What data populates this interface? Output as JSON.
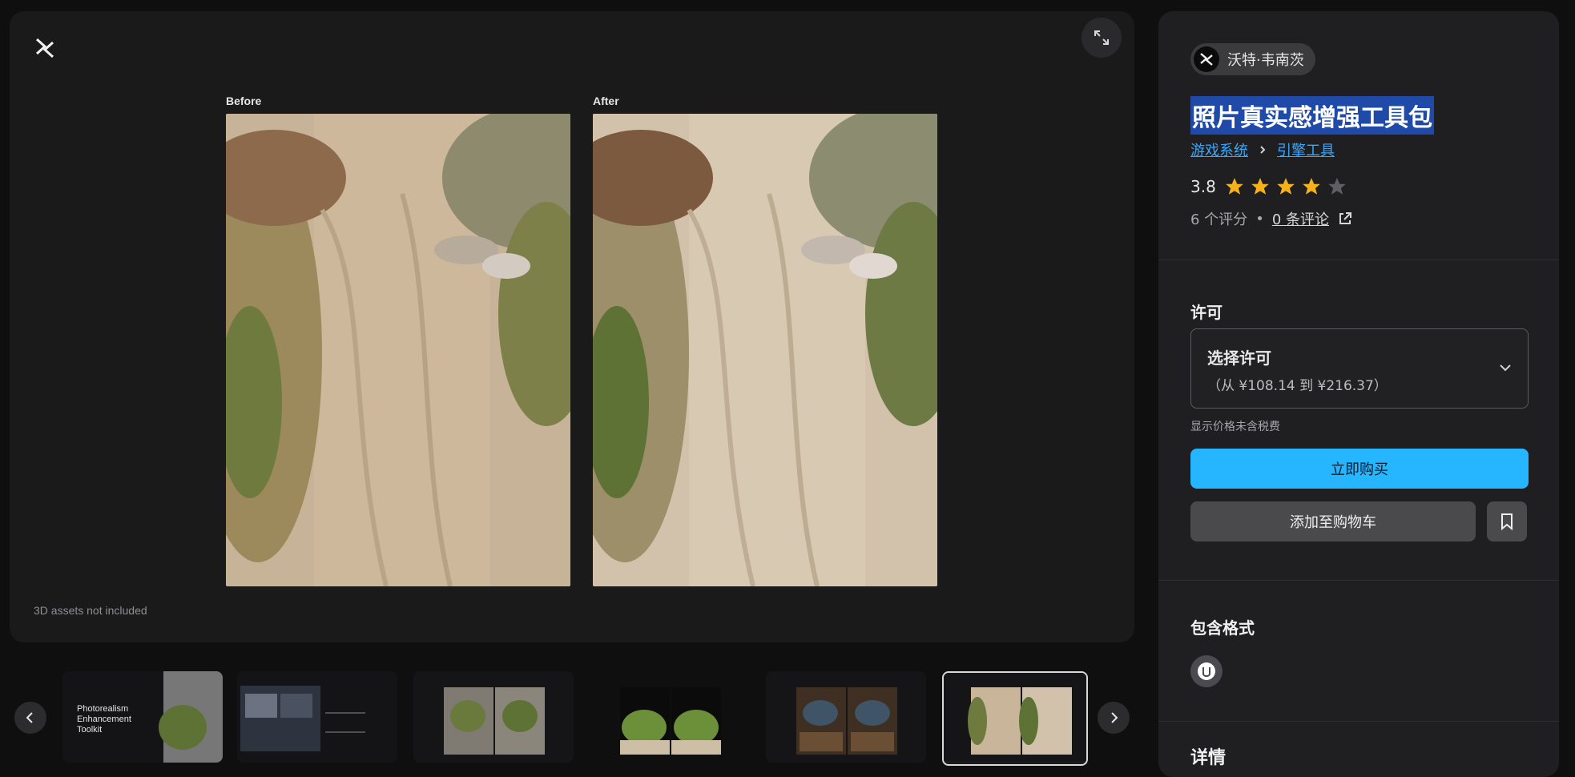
{
  "viewer": {
    "before_label": "Before",
    "after_label": "After",
    "note": "3D assets not included"
  },
  "thumbnails": {
    "count": 6,
    "active_index": 5,
    "first_caption_lines": [
      "Photorealism",
      "Enhancement",
      "Toolkit"
    ]
  },
  "sidebar": {
    "seller": {
      "name": "沃特·韦南茨"
    },
    "title": "照片真实感增强工具包",
    "breadcrumbs": [
      "游戏系统",
      "引擎工具"
    ],
    "rating": {
      "value": "3.8",
      "stars": 3.8,
      "max": 5
    },
    "counts": {
      "ratings": "6 个评分",
      "dot": "•",
      "reviews": "0 条评论"
    },
    "license": {
      "heading": "许可",
      "select_title": "选择许可",
      "range": "（从 ¥108.14 到 ¥216.37）",
      "tax_note": "显示价格未含税费"
    },
    "buttons": {
      "buy": "立即购买",
      "add_to_cart": "添加至购物车"
    },
    "formats": {
      "heading": "包含格式",
      "icon": "unreal-engine-icon"
    },
    "details": {
      "heading": "详情"
    }
  },
  "colors": {
    "accent": "#25b6ff",
    "link": "#36a9ff",
    "star": "#f6b21b",
    "title_highlight": "#1f4aa7"
  }
}
